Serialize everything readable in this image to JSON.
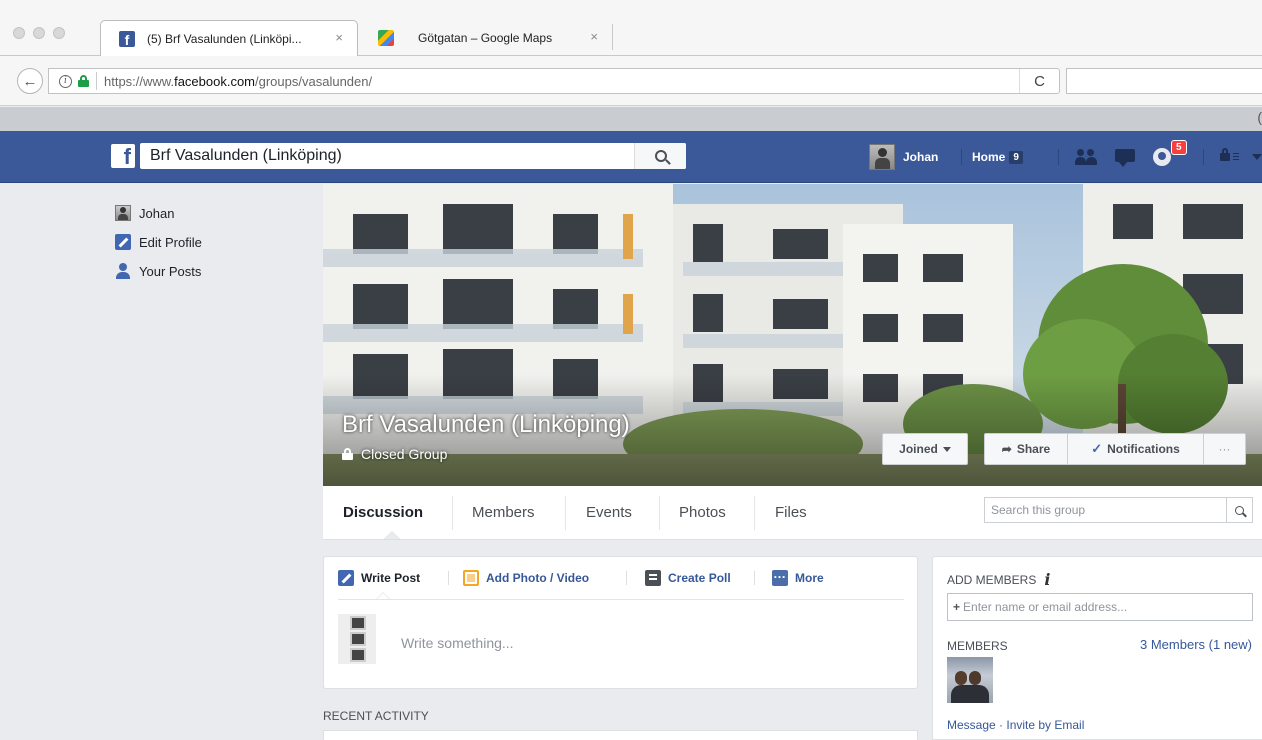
{
  "browser": {
    "tabs": [
      {
        "title": "(5) Brf Vasalunden (Linköpi...",
        "close": "×",
        "favicon": "f"
      },
      {
        "title": "Götgatan – Google Maps",
        "close": "×"
      }
    ],
    "url_prefix": "https://www.",
    "url_domain": "facebook.com",
    "url_path": "/groups/vasalunden/",
    "back_icon": "←",
    "reload_icon": "C",
    "info_icon": "i",
    "strip_fragment": "(",
    "search_placeholder": ""
  },
  "fb": {
    "logo": "f",
    "search_value": "Brf Vasalunden (Linköping)",
    "user_name": "Johan",
    "home_label": "Home",
    "home_count": "9",
    "notif_count": "5"
  },
  "sidebar": {
    "items": [
      {
        "label": "Johan",
        "icon": "avatar-icon"
      },
      {
        "label": "Edit Profile",
        "icon": "pencil-icon"
      },
      {
        "label": "Your Posts",
        "icon": "person-icon"
      }
    ]
  },
  "group": {
    "name": "Brf Vasalunden (Linköping)",
    "privacy": "Closed Group",
    "joined_label": "Joined",
    "share_label": "Share",
    "notifications_label": "Notifications",
    "more_label": "···",
    "tabs": [
      "Discussion",
      "Members",
      "Events",
      "Photos",
      "Files"
    ],
    "search_placeholder": "Search this group"
  },
  "composer": {
    "tabs": [
      "Write Post",
      "Add Photo / Video",
      "Create Poll",
      "More"
    ],
    "placeholder": "Write something..."
  },
  "recent_activity_label": "RECENT ACTIVITY",
  "right": {
    "add_members_label": "ADD MEMBERS",
    "info_icon": "i",
    "add_input_plus": "+",
    "add_input_placeholder": "Enter name or email address...",
    "members_label": "MEMBERS",
    "members_count": "3 Members (1 new)",
    "links": "Message · Invite by Email"
  },
  "colors": {
    "fb_blue": "#3b5998",
    "link_blue": "#365899",
    "page_bg": "#e9ebee",
    "badge_red": "#fa3e3e"
  }
}
